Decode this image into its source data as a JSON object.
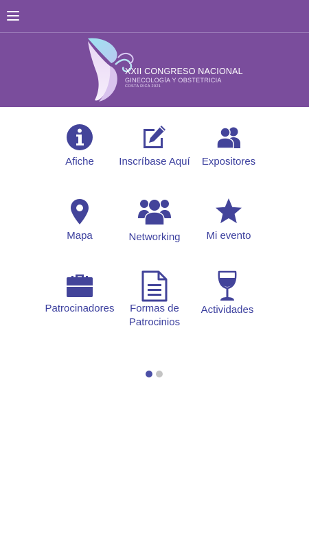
{
  "header": {
    "menu_icon": "hamburger-menu-icon",
    "background": "#7a4d9c"
  },
  "banner": {
    "logo_title": "XXII CONGRESO NACIONAL",
    "logo_subtitle": "GINECOLOGÍA Y OBSTETRICIA",
    "logo_location": "COSTA RICA 2021"
  },
  "menu": {
    "icon_color": "#43449a",
    "label_color": "#3b3f9e",
    "items": [
      {
        "label": "Afiche",
        "icon": "info-icon"
      },
      {
        "label": "Inscríbase Aquí",
        "icon": "edit-icon"
      },
      {
        "label": "Expositores",
        "icon": "users-icon"
      },
      {
        "label": "Mapa",
        "icon": "map-marker-icon"
      },
      {
        "label": "Networking",
        "icon": "group-icon"
      },
      {
        "label": "Mi evento",
        "icon": "star-icon"
      },
      {
        "label": "Patrocinadores",
        "icon": "briefcase-icon"
      },
      {
        "label": "Formas de Patrocinios",
        "icon": "document-icon"
      },
      {
        "label": "Actividades",
        "icon": "wine-glass-icon"
      }
    ]
  },
  "pager": {
    "pages": 2,
    "active_index": 0,
    "active_color": "#4b4fa6",
    "inactive_color": "#c4c4c4"
  }
}
